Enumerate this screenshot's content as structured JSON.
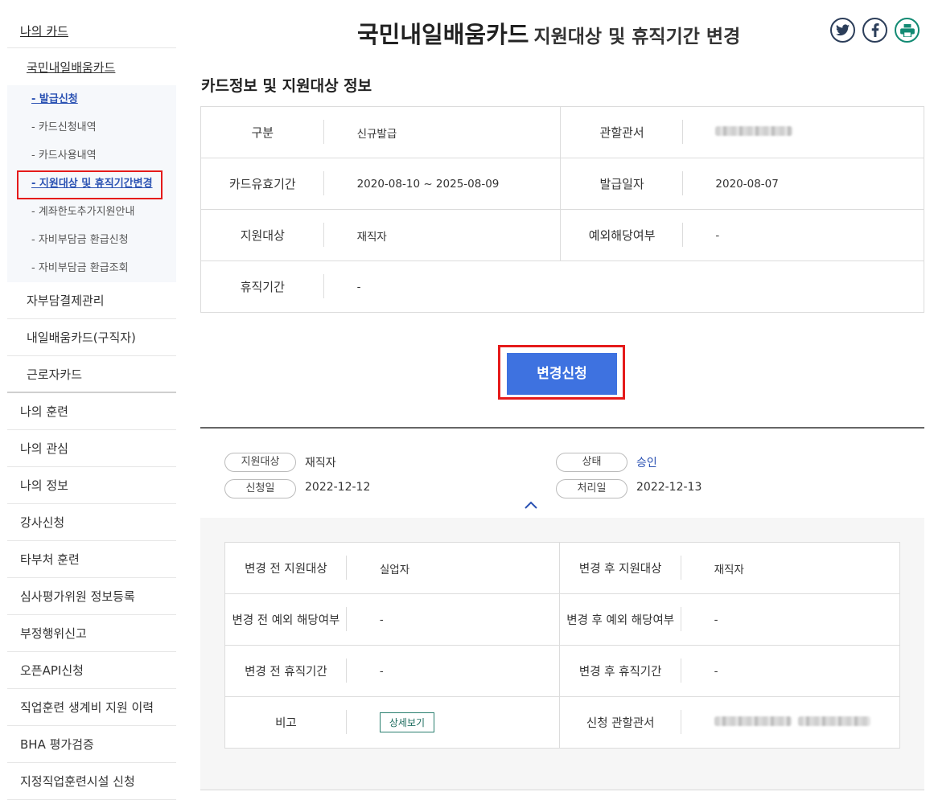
{
  "sidebar": {
    "top": "나의 카드",
    "sub_title": "국민내일배움카드",
    "sub_items": [
      {
        "label": "- 발급신청"
      },
      {
        "label": "- 카드신청내역"
      },
      {
        "label": "- 카드사용내역"
      },
      {
        "label": "- 지원대상 및 휴직기간변경"
      },
      {
        "label": "- 계좌한도추가지원안내"
      },
      {
        "label": "- 자비부담금 환급신청"
      },
      {
        "label": "- 자비부담금 환급조회"
      }
    ],
    "card_items": [
      {
        "label": "자부담결제관리"
      },
      {
        "label": "내일배움카드(구직자)"
      },
      {
        "label": "근로자카드"
      }
    ],
    "items": [
      {
        "label": "나의 훈련"
      },
      {
        "label": "나의 관심"
      },
      {
        "label": "나의 정보"
      },
      {
        "label": "강사신청"
      },
      {
        "label": "타부처 훈련"
      },
      {
        "label": "심사평가위원 정보등록"
      },
      {
        "label": "부정행위신고"
      },
      {
        "label": "오픈API신청"
      },
      {
        "label": "직업훈련 생계비 지원 이력"
      },
      {
        "label": "BHA 평가검증"
      },
      {
        "label": "지정직업훈련시설 신청"
      }
    ]
  },
  "header": {
    "title_main": "국민내일배움카드",
    "title_sub": "지원대상 및 휴직기간 변경",
    "share_icons": [
      "twitter-icon",
      "facebook-icon",
      "print-icon"
    ]
  },
  "section": {
    "title": "카드정보 및 지원대상 정보"
  },
  "card_info": {
    "type_label": "구분",
    "type_value": "신규발급",
    "office_label": "관할관서",
    "validity_label": "카드유효기간",
    "validity_value": "2020-08-10 ~ 2025-08-09",
    "issue_date_label": "발급일자",
    "issue_date_value": "2020-08-07",
    "target_label": "지원대상",
    "target_value": "재직자",
    "exception_label": "예외해당여부",
    "exception_value": "-",
    "leave_label": "휴직기간",
    "leave_value": "-"
  },
  "change_button": "변경신청",
  "history": {
    "target_label": "지원대상",
    "target_value": "재직자",
    "status_label": "상태",
    "status_value": "승인",
    "apply_date_label": "신청일",
    "apply_date_value": "2022-12-12",
    "process_date_label": "처리일",
    "process_date_value": "2022-12-13"
  },
  "detail": {
    "before_target_label": "변경 전 지원대상",
    "before_target_value": "실업자",
    "after_target_label": "변경 후 지원대상",
    "after_target_value": "재직자",
    "before_exception_label": "변경 전 예외 해당여부",
    "before_exception_value": "-",
    "after_exception_label": "변경 후 예외 해당여부",
    "after_exception_value": "-",
    "before_leave_label": "변경 전 휴직기간",
    "before_leave_value": "-",
    "after_leave_label": "변경 후 휴직기간",
    "after_leave_value": "-",
    "note_label": "비고",
    "note_button": "상세보기",
    "office_label": "신청 관할관서"
  },
  "colors": {
    "accent": "#3e72e0",
    "highlight": "#e51b1b",
    "link_active": "#2b52b3",
    "print_icon": "#128a73"
  }
}
